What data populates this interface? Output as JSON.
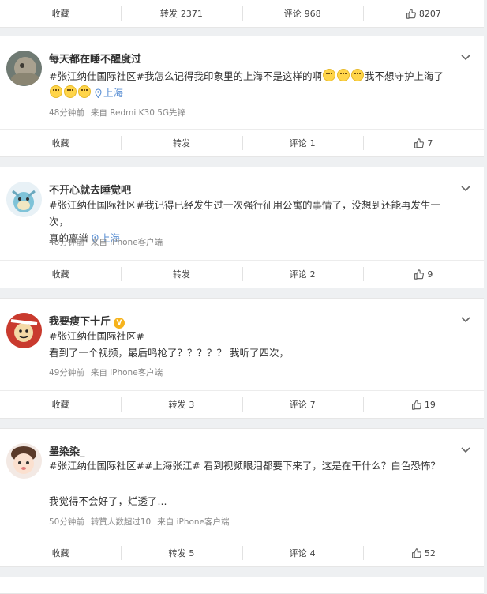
{
  "top_bar": {
    "favorite_label": "收藏",
    "repost_label": "转发",
    "repost_count": "2371",
    "comment_label": "评论",
    "comment_count": "968",
    "like_count": "8207"
  },
  "posts": [
    {
      "username": "每天都在睡不醒度过",
      "text_line1": "#张江纳仕国际社区#我怎么记得我印象里的上海不是这样的啊",
      "text_after_emoji": "我不想守护上海了",
      "location": "上海",
      "time": "48分钟前",
      "source": "来自 Redmi K30 5G先锋",
      "favorite_label": "收藏",
      "repost_label": "转发",
      "comment_label": "评论",
      "comment_count": "1",
      "like_count": "7"
    },
    {
      "username": "不开心就去睡觉吧",
      "text_line1": "#张江纳仕国际社区#我记得已经发生过一次强行征用公寓的事情了，没想到还能再发生一次，",
      "text_line2": "真的离谱",
      "location": "上海",
      "time": "48分钟前",
      "source": "来自 iPhone客户端",
      "favorite_label": "收藏",
      "repost_label": "转发",
      "comment_label": "评论",
      "comment_count": "2",
      "like_count": "9"
    },
    {
      "username": "我要瘦下十斤",
      "text_line1": "#张江纳仕国际社区#",
      "text_line2": "看到了一个视频，最后鸣枪了？？？？？ 我听了四次，",
      "time": "49分钟前",
      "source": "来自 iPhone客户端",
      "favorite_label": "收藏",
      "repost_label": "转发",
      "repost_count": "3",
      "comment_label": "评论",
      "comment_count": "7",
      "like_count": "19"
    },
    {
      "username": "墨染染_",
      "text_line1": "#张江纳仕国际社区##上海张江# 看到视频眼泪都要下来了，这是在干什么？白色恐怖？",
      "text_line2": "我觉得不会好了，烂透了...",
      "time": "50分钟前",
      "extra": "转赞人数超过10",
      "source": "来自 iPhone客户端",
      "favorite_label": "收藏",
      "repost_label": "转发",
      "repost_count": "5",
      "comment_label": "评论",
      "comment_count": "4",
      "like_count": "52"
    }
  ],
  "colors": {
    "link": "#5a8fd3",
    "badge": "#f6b31c",
    "background": "#eef0f2"
  },
  "icons": [
    "chevron-down-icon",
    "thumb-up-icon",
    "location-pin-icon",
    "verified-badge-icon"
  ]
}
